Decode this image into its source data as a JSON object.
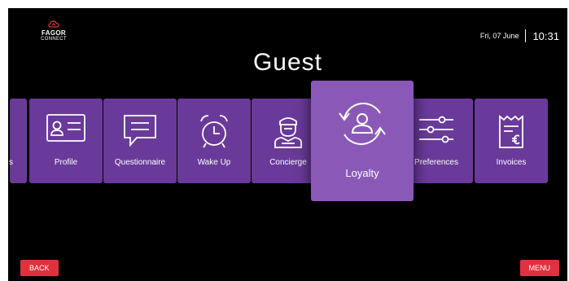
{
  "brand": {
    "name": "FAGOR",
    "sub": "CONNECT"
  },
  "header": {
    "date": "Fri, 07 June",
    "time": "10:31"
  },
  "page_title": "Guest",
  "cards": [
    {
      "label": "s",
      "icon": "partial-icon"
    },
    {
      "label": "Profile",
      "icon": "id-card-icon"
    },
    {
      "label": "Questionnaire",
      "icon": "chat-bubble-icon"
    },
    {
      "label": "Wake Up",
      "icon": "alarm-clock-icon"
    },
    {
      "label": "Concierge",
      "icon": "concierge-icon"
    },
    {
      "label": "Loyalty",
      "icon": "loyalty-icon",
      "active": true
    },
    {
      "label": "Preferences",
      "icon": "sliders-icon"
    },
    {
      "label": "Invoices",
      "icon": "invoice-icon"
    }
  ],
  "footer": {
    "back_label": "BACK",
    "menu_label": "MENU"
  },
  "colors": {
    "card": "#6a3a9a",
    "card_active": "#8a59b8",
    "button": "#e0323e",
    "background": "#000000"
  }
}
